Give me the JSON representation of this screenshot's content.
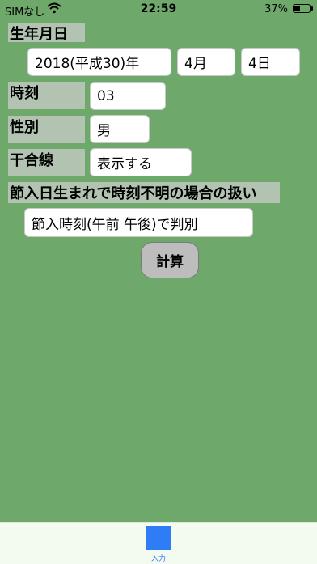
{
  "status_bar": {
    "carrier": "SIMなし",
    "time": "22:59",
    "battery_percent": "37%",
    "battery_level": 0.37
  },
  "form": {
    "birth_date": {
      "label": "生年月日",
      "year": "2018(平成30)年",
      "month": "4月",
      "day": "4日"
    },
    "time": {
      "label": "時刻",
      "value": "03"
    },
    "gender": {
      "label": "性別",
      "value": "男"
    },
    "kangosen": {
      "label": "干合線",
      "value": "表示する"
    },
    "setsuiri": {
      "label": "節入日生まれで時刻不明の場合の扱い",
      "value": "節入時刻(午前 午後)で判別"
    },
    "calculate_label": "計算"
  },
  "tab_bar": {
    "items": [
      {
        "label": "入力",
        "icon": "square-icon",
        "color": "#2f7df6"
      }
    ]
  }
}
